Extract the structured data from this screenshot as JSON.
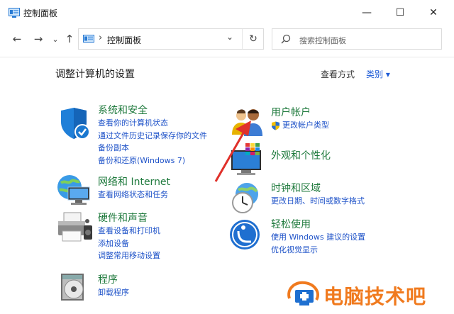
{
  "window": {
    "title": "控制面板",
    "controls": {
      "minimize": "—",
      "maximize": "☐",
      "close": "✕"
    }
  },
  "address": {
    "back": "←",
    "forward": "→",
    "recent": "⌄",
    "up": "↑",
    "separator": "›",
    "path": "控制面板",
    "dropdown": "⌄",
    "refresh": "↻"
  },
  "search": {
    "placeholder": "搜索控制面板"
  },
  "main": {
    "heading": "调整计算机的设置",
    "view_by_label": "查看方式",
    "view_by_value": "类别 ▾"
  },
  "categories": {
    "system": {
      "title": "系统和安全",
      "links": [
        "查看你的计算机状态",
        "通过文件历史记录保存你的文件",
        "备份副本",
        "备份和还原(Windows 7)"
      ]
    },
    "network": {
      "title": "网络和 Internet",
      "links": [
        "查看网络状态和任务"
      ]
    },
    "hardware": {
      "title": "硬件和声音",
      "links": [
        "查看设备和打印机",
        "添加设备",
        "调整常用移动设置"
      ]
    },
    "programs": {
      "title": "程序",
      "links": [
        "卸载程序"
      ]
    },
    "user": {
      "title": "用户帐户",
      "links": [
        "更改帐户类型"
      ]
    },
    "appearance": {
      "title": "外观和个性化",
      "links": []
    },
    "clock": {
      "title": "时钟和区域",
      "links": [
        "更改日期、时间或数字格式"
      ]
    },
    "ease": {
      "title": "轻松使用",
      "links": [
        "使用 Windows 建议的设置",
        "优化视觉显示"
      ]
    }
  },
  "watermark": {
    "text": "电脑技术吧"
  },
  "colors": {
    "title_green": "#1f7a3d",
    "link_blue": "#1e52c8",
    "arrow_red": "#e0302a",
    "watermark_orange": "#f07a1e"
  }
}
